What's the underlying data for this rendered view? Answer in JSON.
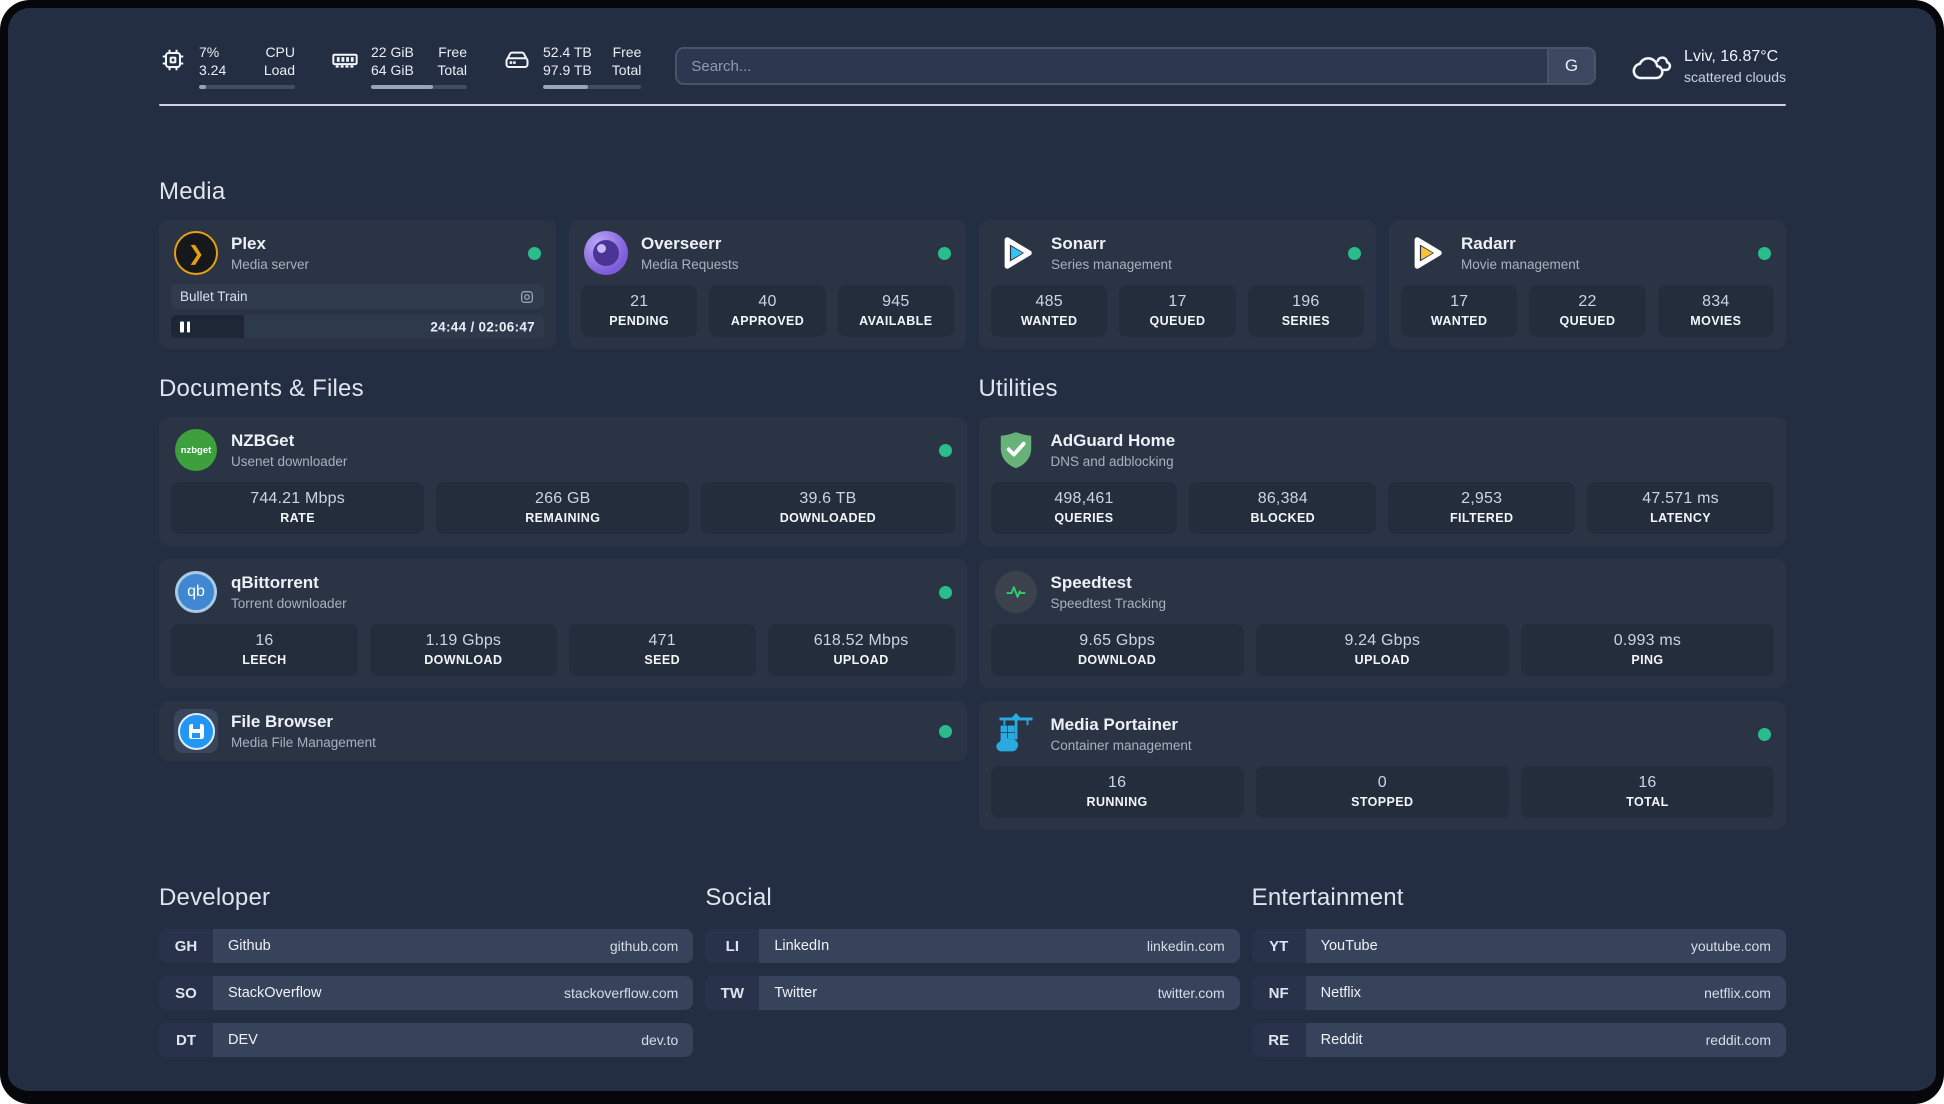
{
  "topbar": {
    "cpu": {
      "value1": "7%",
      "value2": "3.24",
      "label1": "CPU",
      "label2": "Load",
      "bar": 7
    },
    "ram": {
      "value1": "22 GiB",
      "value2": "64 GiB",
      "label1": "Free",
      "label2": "Total",
      "bar": 65
    },
    "disk": {
      "value1": "52.4 TB",
      "value2": "97.9 TB",
      "label1": "Free",
      "label2": "Total",
      "bar": 46
    },
    "search": {
      "placeholder": "Search...",
      "button_label": "G"
    },
    "weather": {
      "location": "Lviv, 16.87°C",
      "condition": "scattered clouds"
    }
  },
  "sections": {
    "media": {
      "title": "Media",
      "plex": {
        "name": "Plex",
        "subtitle": "Media server",
        "status": "online",
        "now_playing": "Bullet Train",
        "time_display": "24:44 / 02:06:47",
        "progress_percent": 19.5
      },
      "overseerr": {
        "name": "Overseerr",
        "subtitle": "Media Requests",
        "status": "online",
        "stats": [
          {
            "value": "21",
            "label": "PENDING"
          },
          {
            "value": "40",
            "label": "APPROVED"
          },
          {
            "value": "945",
            "label": "AVAILABLE"
          }
        ]
      },
      "sonarr": {
        "name": "Sonarr",
        "subtitle": "Series management",
        "status": "online",
        "stats": [
          {
            "value": "485",
            "label": "WANTED"
          },
          {
            "value": "17",
            "label": "QUEUED"
          },
          {
            "value": "196",
            "label": "SERIES"
          }
        ]
      },
      "radarr": {
        "name": "Radarr",
        "subtitle": "Movie management",
        "status": "online",
        "stats": [
          {
            "value": "17",
            "label": "WANTED"
          },
          {
            "value": "22",
            "label": "QUEUED"
          },
          {
            "value": "834",
            "label": "MOVIES"
          }
        ]
      }
    },
    "documents": {
      "title": "Documents & Files",
      "nzbget": {
        "name": "NZBGet",
        "subtitle": "Usenet downloader",
        "status": "online",
        "icon_label": "nzbget",
        "stats": [
          {
            "value": "744.21 Mbps",
            "label": "RATE"
          },
          {
            "value": "266 GB",
            "label": "REMAINING"
          },
          {
            "value": "39.6 TB",
            "label": "DOWNLOADED"
          }
        ]
      },
      "qbittorrent": {
        "name": "qBittorrent",
        "subtitle": "Torrent downloader",
        "status": "online",
        "icon_label": "qb",
        "stats": [
          {
            "value": "16",
            "label": "LEECH"
          },
          {
            "value": "1.19 Gbps",
            "label": "DOWNLOAD"
          },
          {
            "value": "471",
            "label": "SEED"
          },
          {
            "value": "618.52 Mbps",
            "label": "UPLOAD"
          }
        ]
      },
      "filebrowser": {
        "name": "File Browser",
        "subtitle": "Media File Management",
        "status": "online"
      }
    },
    "utilities": {
      "title": "Utilities",
      "adguard": {
        "name": "AdGuard Home",
        "subtitle": "DNS and adblocking",
        "stats": [
          {
            "value": "498,461",
            "label": "QUERIES"
          },
          {
            "value": "86,384",
            "label": "BLOCKED"
          },
          {
            "value": "2,953",
            "label": "FILTERED"
          },
          {
            "value": "47.571 ms",
            "label": "LATENCY"
          }
        ]
      },
      "speedtest": {
        "name": "Speedtest",
        "subtitle": "Speedtest Tracking",
        "stats": [
          {
            "value": "9.65 Gbps",
            "label": "DOWNLOAD"
          },
          {
            "value": "9.24 Gbps",
            "label": "UPLOAD"
          },
          {
            "value": "0.993 ms",
            "label": "PING"
          }
        ]
      },
      "portainer": {
        "name": "Media Portainer",
        "subtitle": "Container management",
        "status": "online",
        "stats": [
          {
            "value": "16",
            "label": "RUNNING"
          },
          {
            "value": "0",
            "label": "STOPPED"
          },
          {
            "value": "16",
            "label": "TOTAL"
          }
        ]
      }
    },
    "links": {
      "developer": {
        "title": "Developer",
        "items": [
          {
            "abbr": "GH",
            "name": "Github",
            "url": "github.com"
          },
          {
            "abbr": "SO",
            "name": "StackOverflow",
            "url": "stackoverflow.com"
          },
          {
            "abbr": "DT",
            "name": "DEV",
            "url": "dev.to"
          }
        ]
      },
      "social": {
        "title": "Social",
        "items": [
          {
            "abbr": "LI",
            "name": "LinkedIn",
            "url": "linkedin.com"
          },
          {
            "abbr": "TW",
            "name": "Twitter",
            "url": "twitter.com"
          }
        ]
      },
      "entertainment": {
        "title": "Entertainment",
        "items": [
          {
            "abbr": "YT",
            "name": "YouTube",
            "url": "youtube.com"
          },
          {
            "abbr": "NF",
            "name": "Netflix",
            "url": "netflix.com"
          },
          {
            "abbr": "RE",
            "name": "Reddit",
            "url": "reddit.com"
          }
        ]
      }
    }
  },
  "colors": {
    "window_bg": "#242e43",
    "card_bg": "#2a3444",
    "tile_bg": "#232d3c",
    "status_online": "#2abd8c",
    "plex_accent": "#e5a00d",
    "sonarr_accent": "#35c5f4",
    "radarr_accent": "#ffc230",
    "nzbget_accent": "#3da03d",
    "qbittorrent_accent": "#3f87d0",
    "filebrowser_accent": "#2196f3",
    "adguard_accent": "#67b279",
    "speedtest_line": "#2ecc71",
    "portainer_accent": "#29abe2"
  }
}
